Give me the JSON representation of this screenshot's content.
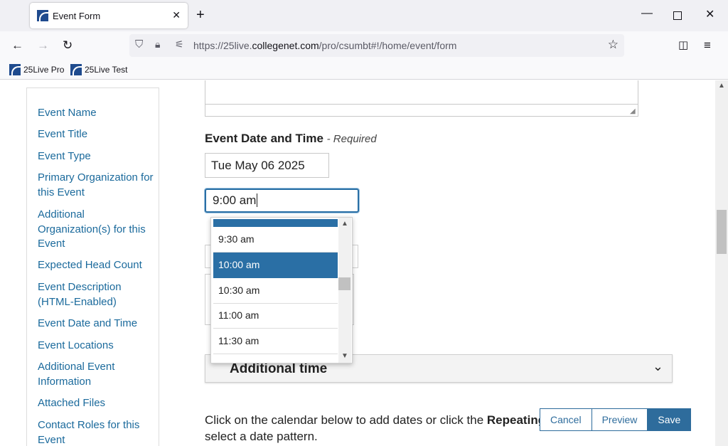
{
  "browser": {
    "tab_title": "Event Form",
    "url_prefix": "https://25live.",
    "url_domain": "collegenet.com",
    "url_path": "/pro/csumbt#!/home/event/form",
    "bookmarks": [
      "25Live Pro",
      "25Live Test"
    ]
  },
  "sidebar": {
    "items": [
      "Event Name",
      "Event Title",
      "Event Type",
      "Primary Organization for this Event",
      "Additional Organization(s) for this Event",
      "Expected Head Count",
      "Event Description (HTML-Enabled)",
      "Event Date and Time",
      "Event Locations",
      "Additional Event Information",
      "Attached Files",
      "Contact Roles for this Event"
    ]
  },
  "form": {
    "section_title": "Event Date and Time",
    "section_required": "- Required",
    "date_value": "Tue May 06 2025",
    "time_value": "9:00 am",
    "time_options": [
      "9:30 am",
      "10:00 am",
      "10:30 am",
      "11:00 am",
      "11:30 am"
    ],
    "selected_option": "10:00 am",
    "additional_time_label": "Additional time",
    "calendar_text_before": "Click on the calendar below to add dates or click the",
    "calendar_text_bold": "Repeating",
    "calendar_text_after": "select a date pattern."
  },
  "actions": {
    "cancel": "Cancel",
    "preview": "Preview",
    "save": "Save"
  },
  "colors": {
    "accent": "#2a6fa5",
    "link": "#1b6a9c"
  }
}
